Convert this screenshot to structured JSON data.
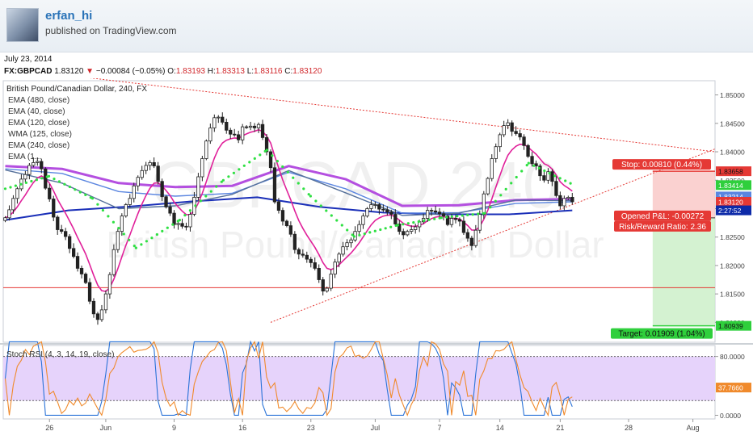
{
  "header": {
    "username": "erfan_hi",
    "published_text": "published on TradingView.com"
  },
  "date": "July 23, 2014",
  "quote": {
    "symbol": "FX:GBPCAD",
    "last": "1.83120",
    "arrow": "▼",
    "change": "−0.00084 (−0.05%)",
    "o_label": "O:",
    "o": "1.83193",
    "h_label": "H:",
    "h": "1.83313",
    "l_label": "L:",
    "l": "1.83116",
    "c_label": "C:",
    "c": "1.83120"
  },
  "chart_data": {
    "type": "candlestick",
    "title": "British Pound/Canadian Dollar, 240, FX",
    "watermark_symbol": "GBPCAD",
    "watermark_interval": "240",
    "watermark_name": "British Pound/Canadian Dollar",
    "indicators": [
      "EMA (480, close)",
      "EMA (40, close)",
      "EMA (120, close)",
      "WMA (125, close)",
      "EMA (240, close)",
      "EMA (1..."
    ],
    "price_axis": {
      "ylim": [
        1.8065,
        1.8525
      ],
      "ticks": [
        "1.85000",
        "1.84500",
        "1.84000",
        "1.83500",
        "1.83000",
        "1.82500",
        "1.82000",
        "1.81500",
        "1.81000"
      ],
      "tick_values": [
        1.85,
        1.845,
        1.84,
        1.835,
        1.83,
        1.825,
        1.82,
        1.815,
        1.81
      ]
    },
    "price_badges": [
      {
        "label": "1.83658",
        "value": 1.83658,
        "color": "#e53935",
        "text": "#111111"
      },
      {
        "label": "1.83414",
        "value": 1.83414,
        "color": "#2fcf3c",
        "text": "#ffffff"
      },
      {
        "label": "1.83214",
        "value": 1.83214,
        "color": "#5b86e0",
        "text": "#ffffff"
      },
      {
        "label": "1.83120",
        "value": 1.8312,
        "color": "#e53935",
        "text": "#ffffff"
      },
      {
        "label": "2:27:52",
        "value": 1.8297,
        "color": "#0d2aa8",
        "text": "#ffffff"
      },
      {
        "label": "1.80939",
        "value": 1.80939,
        "color": "#2fcf3c",
        "text": "#111111"
      }
    ],
    "x_axis": {
      "ticks": [
        "26",
        "Jun",
        "9",
        "16",
        "23",
        "Jul",
        "7",
        "14",
        "21",
        "28",
        "Aug"
      ],
      "tick_index": [
        11,
        25,
        42,
        59,
        76,
        92,
        108,
        123,
        138,
        155,
        171
      ]
    },
    "candles": {
      "close": [
        1.8284,
        1.8298,
        1.8318,
        1.8335,
        1.8352,
        1.836,
        1.8376,
        1.8381,
        1.8383,
        1.837,
        1.8336,
        1.8317,
        1.8285,
        1.8263,
        1.826,
        1.8251,
        1.823,
        1.8216,
        1.8195,
        1.8185,
        1.817,
        1.8137,
        1.8115,
        1.8105,
        1.8122,
        1.815,
        1.8184,
        1.8228,
        1.826,
        1.8287,
        1.8307,
        1.8318,
        1.834,
        1.8355,
        1.8367,
        1.8376,
        1.8381,
        1.8375,
        1.8348,
        1.8321,
        1.8303,
        1.8292,
        1.8272,
        1.8274,
        1.8269,
        1.8268,
        1.829,
        1.832,
        1.8356,
        1.8388,
        1.8419,
        1.8442,
        1.846,
        1.8461,
        1.8452,
        1.8438,
        1.8431,
        1.843,
        1.8421,
        1.8444,
        1.8443,
        1.8445,
        1.8442,
        1.8448,
        1.8425,
        1.84,
        1.8372,
        1.8312,
        1.8297,
        1.8278,
        1.827,
        1.8255,
        1.8228,
        1.822,
        1.8218,
        1.8211,
        1.8205,
        1.8195,
        1.8175,
        1.8155,
        1.816,
        1.8185,
        1.8206,
        1.822,
        1.8233,
        1.824,
        1.8245,
        1.826,
        1.8272,
        1.8287,
        1.83,
        1.8307,
        1.8307,
        1.8299,
        1.8298,
        1.8294,
        1.829,
        1.8273,
        1.826,
        1.8254,
        1.826,
        1.8263,
        1.8268,
        1.8277,
        1.8283,
        1.8297,
        1.8296,
        1.8294,
        1.8291,
        1.8287,
        1.8272,
        1.8283,
        1.8281,
        1.8278,
        1.8258,
        1.8248,
        1.8235,
        1.8262,
        1.829,
        1.8326,
        1.8353,
        1.8388,
        1.8409,
        1.843,
        1.8446,
        1.8451,
        1.8436,
        1.8432,
        1.8426,
        1.8411,
        1.8392,
        1.8379,
        1.8375,
        1.8358,
        1.835,
        1.8365,
        1.8348,
        1.8323,
        1.8305,
        1.8318,
        1.832,
        1.8312
      ],
      "high_offset": 0.0007,
      "low_offset": 0.0007
    },
    "series": [
      {
        "name": "EMA (480, close)",
        "color": "#1a2fb8",
        "values": [
          1.828,
          1.8297,
          1.8304,
          1.8313,
          1.832,
          1.8303,
          1.8293,
          1.829,
          1.829,
          1.8297
        ]
      },
      {
        "name": "EMA (240, close)",
        "color": "#b44fe0",
        "values": [
          1.8375,
          1.837,
          1.8345,
          1.8338,
          1.834,
          1.8375,
          1.8352,
          1.8305,
          1.8306,
          1.8315,
          1.8317
        ]
      },
      {
        "name": "EMA (120, close)",
        "color": "#5b86e0",
        "values": [
          1.837,
          1.8362,
          1.833,
          1.8322,
          1.8327,
          1.8364,
          1.8335,
          1.8292,
          1.8293,
          1.8309,
          1.8312
        ]
      },
      {
        "name": "WMA (125, close)",
        "color": "#55709a",
        "values": [
          1.8368,
          1.8345,
          1.83,
          1.8305,
          1.8325,
          1.8367,
          1.8328,
          1.8288,
          1.8292,
          1.8315,
          1.8314
        ]
      },
      {
        "name": "EMA (40, close)",
        "color": "#2fe043",
        "values": [
          1.8335,
          1.8357,
          1.8318,
          1.8231,
          1.828,
          1.835,
          1.8403,
          1.8322,
          1.8251,
          1.8271,
          1.8284,
          1.8292,
          1.838,
          1.8343
        ]
      }
    ],
    "annotations": {
      "stop": "Stop: 0.00810 (0.44%)",
      "target": "Target: 0.01909 (1.04%)",
      "pnl": "Opened P&L: -0.00272",
      "risk": "Risk/Reward Ratio: 2.36",
      "stop_price": 1.83658,
      "entry_price": 1.82838,
      "target_price": 1.80939,
      "horizontal_line": 1.8161
    },
    "stoch_rsi": {
      "label": "Stoch RSI (4, 3, 14, 19, close)",
      "ylim": [
        -5,
        95
      ],
      "upper_band": 80,
      "lower_band": 20,
      "ticks": [
        "80.0000",
        "0.0000"
      ],
      "tick_values": [
        80,
        0
      ],
      "last_label": "37.7660",
      "last_value": 37.766
    }
  }
}
